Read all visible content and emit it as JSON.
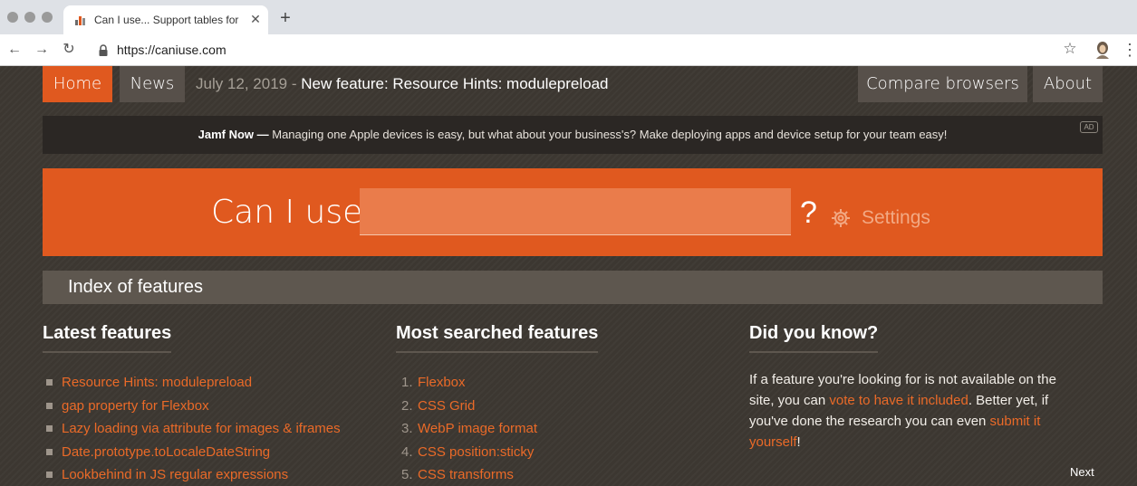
{
  "browser": {
    "tab_title": "Can I use... Support tables for",
    "tab_close": "✕",
    "new_tab": "+",
    "url": "https://caniuse.com",
    "back": "←",
    "forward": "→",
    "reload": "↻",
    "star": "☆",
    "menu": "⋮",
    "icons": [
      "favicon-icon",
      "close-icon",
      "plus-icon",
      "back-arrow-icon",
      "forward-arrow-icon",
      "reload-icon",
      "lock-icon",
      "star-icon",
      "profile-avatar-icon",
      "kebab-menu-icon"
    ]
  },
  "nav": {
    "home": "Home",
    "news": "News",
    "news_date": "July 12, 2019",
    "news_sep": "-",
    "news_headline": "New feature: Resource Hints: modulepreload",
    "compare": "Compare browsers",
    "about": "About"
  },
  "ad": {
    "brand": "Jamf Now —",
    "text": "Managing one Apple devices is easy, but what about your business's? Make deploying apps and device setup for your team easy!",
    "badge": "AD"
  },
  "search": {
    "label": "Can I use",
    "value": "",
    "question": "?",
    "settings_label": "Settings"
  },
  "index_title": "Index of features",
  "latest": {
    "heading": "Latest features",
    "items": [
      "Resource Hints: modulepreload",
      "gap property for Flexbox",
      "Lazy loading via attribute for images & iframes",
      "Date.prototype.toLocaleDateString",
      "Lookbehind in JS regular expressions"
    ]
  },
  "searched": {
    "heading": "Most searched features",
    "items": [
      {
        "num": "1.",
        "label": "Flexbox"
      },
      {
        "num": "2.",
        "label": "CSS Grid"
      },
      {
        "num": "3.",
        "label": "WebP image format"
      },
      {
        "num": "4.",
        "label": "CSS position:sticky"
      },
      {
        "num": "5.",
        "label": "CSS transforms"
      }
    ]
  },
  "dyk": {
    "heading": "Did you know?",
    "text_1": "If a feature you're looking for is not available on the site, you can ",
    "link_1": "vote to have it included",
    "text_2": ". Better yet, if you've done the research you can even ",
    "link_2": "submit it yourself",
    "text_3": "!",
    "next": "Next"
  },
  "colors": {
    "accent": "#e0591f",
    "link": "#ea6a28",
    "background": "#3c3731",
    "nav_box": "#57504a",
    "index_bar": "#5e574f"
  }
}
